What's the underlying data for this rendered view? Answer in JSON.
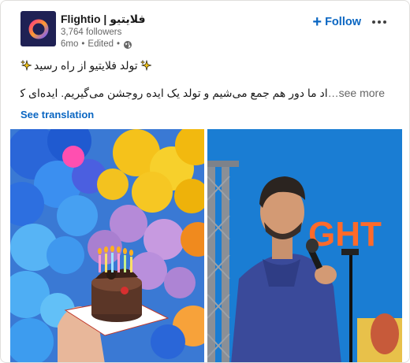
{
  "company": {
    "name": "Flightio | فلایتیو",
    "followers": "3,764 followers",
    "time": "6mo",
    "edited": "Edited",
    "separator": "•"
  },
  "actions": {
    "follow_label": "Follow",
    "follow_icon": "plus-icon",
    "more_icon": "more-options-icon"
  },
  "post": {
    "title": "تولد فلایتیو از راه رسید",
    "excerpt": "اد ما دور هم جمع می‌شیم و تولد یک ایده روجشن می‌گیریم. ایده‌ای که به خاطر",
    "see_more": "…see more",
    "see_translation": "See translation"
  },
  "images": {
    "right_sign_text": "GHT"
  },
  "colors": {
    "accent": "#0a66c2",
    "logo_bg": "#1f2154",
    "wall_blue": "#1a7fd8",
    "sign_orange": "#ff6a2a"
  }
}
